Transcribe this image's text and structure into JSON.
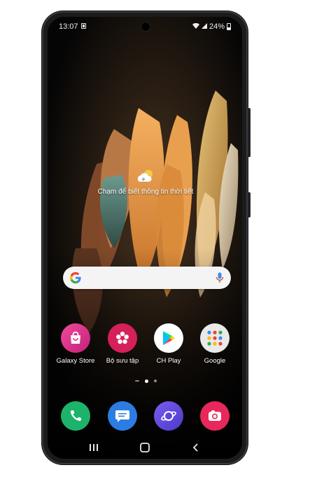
{
  "status_bar": {
    "time": "13:07",
    "battery": "24%"
  },
  "weather": {
    "text": "Chạm để biết thông tin thời tiết",
    "icon": "cloud-sun-icon"
  },
  "search_bar": {
    "left_icon": "google-g-icon",
    "right_icon": "microphone-icon"
  },
  "apps": [
    {
      "label": "Galaxy Store",
      "icon": "shopping-bag-icon",
      "color": "#e8267c"
    },
    {
      "label": "Bộ sưu tập",
      "icon": "flower-icon",
      "color": "#d6205a"
    },
    {
      "label": "CH Play",
      "icon": "play-triangle-icon",
      "color": "#ffffff"
    },
    {
      "label": "Google",
      "icon": "folder-icon",
      "color": "#e9e9e9"
    }
  ],
  "dock": [
    {
      "name": "phone",
      "icon": "phone-handset-icon",
      "color": "#1db36b"
    },
    {
      "name": "messages",
      "icon": "message-bubble-icon",
      "color": "#2b7de3"
    },
    {
      "name": "internet",
      "icon": "planet-icon",
      "color": "#6a4de8"
    },
    {
      "name": "camera",
      "icon": "camera-icon",
      "color": "#e8285a"
    }
  ],
  "page_indicator": {
    "pages": 3,
    "active": 2
  },
  "nav_bar": {
    "buttons": [
      "recents-icon",
      "home-icon",
      "back-icon"
    ]
  }
}
